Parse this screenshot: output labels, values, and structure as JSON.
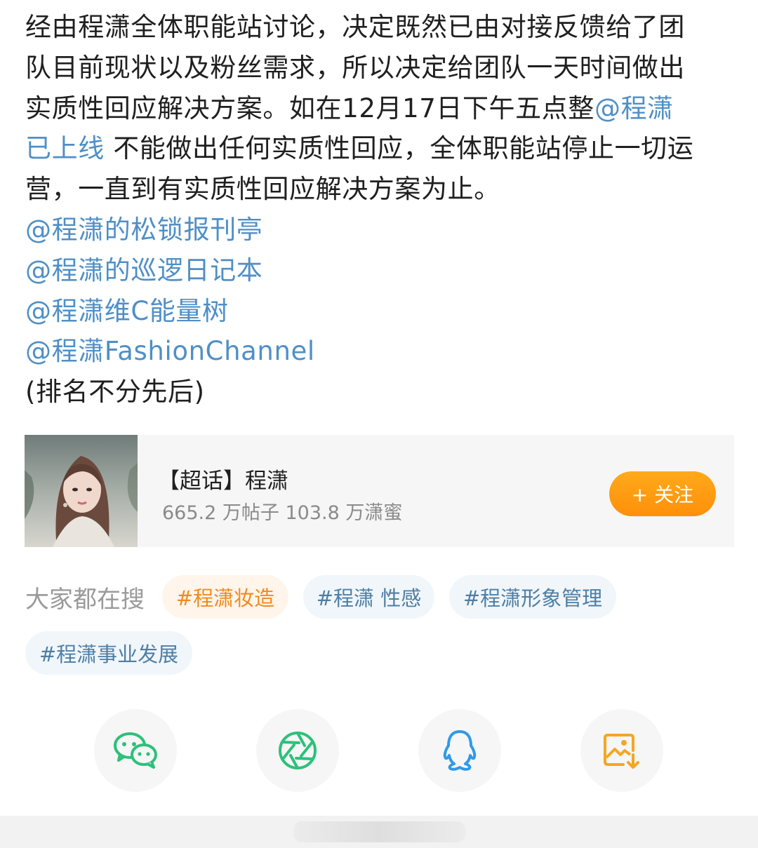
{
  "post": {
    "line1": "经由程潇全体职能站讨论，决定既然已由对接反馈给了团",
    "line2": "队目前现状以及粉丝需求，所以决定给团队一天时间做出",
    "line3_text": "实质性回应解决方案。如在12月17日下午五点整",
    "line3_mention": "@程潇",
    "line4_mention": "已上线",
    "line4_text": "不能做出任何实质性回应，全体职能站停止一切运",
    "line5": "营，一直到有实质性回应解决方案为止。",
    "mentions": [
      "@程潇的松锁报刊亭",
      "@程潇的巡逻日记本",
      "@程潇维C能量树",
      "@程潇FashionChannel"
    ],
    "footnote": "(排名不分先后)"
  },
  "supertopic": {
    "title": "【超话】程潇",
    "stats": "665.2 万帖子 103.8 万潇蜜",
    "follow_label": "+ 关注"
  },
  "search": {
    "label": "大家都在搜",
    "chips": [
      "#程潇妆造",
      "#程潇 性感",
      "#程潇形象管理",
      "#程潇事业发展"
    ]
  },
  "share": {
    "items": [
      "wechat-icon",
      "moments-icon",
      "qq-icon",
      "save-image-icon"
    ]
  },
  "colors": {
    "mention": "#4f8fc6",
    "follow_button": "#ff9a12",
    "hot_chip_text": "#f08a1e",
    "chip_text": "#4e7ea4",
    "wechat_green": "#2ec07a",
    "qq_blue": "#2f9ae8",
    "save_orange": "#f5a623"
  }
}
